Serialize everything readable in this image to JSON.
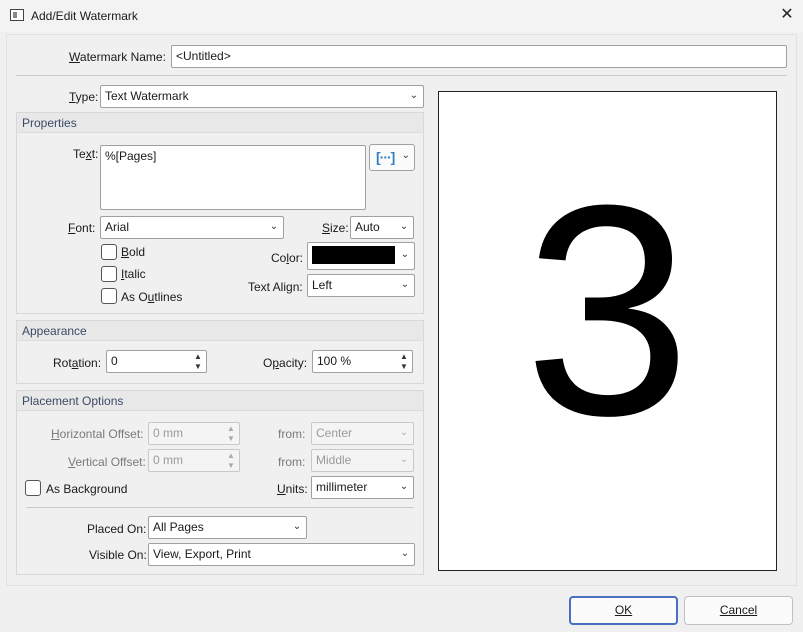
{
  "window": {
    "title": "Add/Edit Watermark",
    "close_glyph": "✕"
  },
  "watermark_name": {
    "label": "Watermark Name:",
    "value": "<Untitled>"
  },
  "type": {
    "label": "Type:",
    "value": "Text Watermark"
  },
  "properties": {
    "header": "Properties",
    "text_label": "Text:",
    "text_value": "%[Pages]",
    "macro_glyph": "[···]",
    "font_label": "Font:",
    "font_value": "Arial",
    "size_label": "Size:",
    "size_value": "Auto",
    "bold_label": "Bold",
    "italic_label": "Italic",
    "outlines_label": "As Outlines",
    "color_label": "Color:",
    "color_value": "#000000",
    "align_label": "Text Align:",
    "align_value": "Left"
  },
  "appearance": {
    "header": "Appearance",
    "rotation_label": "Rotation:",
    "rotation_value": "0",
    "opacity_label": "Opacity:",
    "opacity_value": "100 %"
  },
  "placement": {
    "header": "Placement Options",
    "h_offset_label": "Horizontal Offset:",
    "h_offset_value": "0 mm",
    "h_from_label": "from:",
    "h_from_value": "Center",
    "v_offset_label": "Vertical Offset:",
    "v_offset_value": "0 mm",
    "v_from_label": "from:",
    "v_from_value": "Middle",
    "background_label": "As Background",
    "units_label": "Units:",
    "units_value": "millimeter",
    "placed_on_label": "Placed On:",
    "placed_on_value": "All Pages",
    "visible_on_label": "Visible On:",
    "visible_on_value": "View, Export, Print"
  },
  "preview": {
    "digit": "3"
  },
  "buttons": {
    "ok": "OK",
    "cancel": "Cancel"
  },
  "icons": {
    "dropdown": "chevron-down-icon",
    "spin_up": "spin-up-icon",
    "spin_down": "spin-down-icon",
    "app": "watermark-app-icon"
  }
}
